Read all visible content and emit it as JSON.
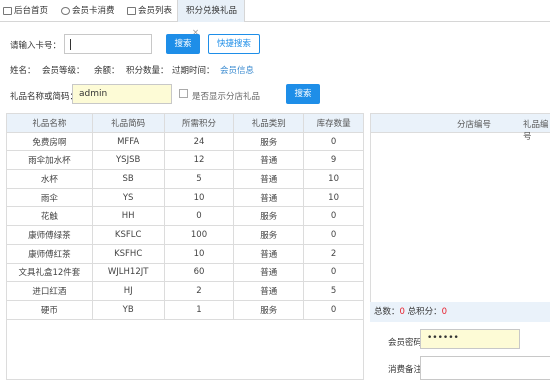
{
  "tabs": [
    {
      "label": "后台首页",
      "icon": "home-icon"
    },
    {
      "label": "会员卡消费",
      "icon": "user-icon"
    },
    {
      "label": "会员列表",
      "icon": "list-icon"
    },
    {
      "label": "积分兑换礼品",
      "icon": "",
      "close": "×"
    }
  ],
  "card": {
    "label": "请输入卡号：",
    "value": "",
    "search_label": "搜索",
    "quick_search_label": "快捷搜索"
  },
  "member": {
    "name_label": "姓名：",
    "level_label": "会员等级：",
    "balance_label": "余额：",
    "points_label": "积分数量：",
    "expire_label": "过期时间：",
    "info_link": "会员信息"
  },
  "gift_filter": {
    "label": "礼品名称或简码：",
    "value": "admin",
    "checkbox_label": "是否显示分店礼品",
    "search_label": "搜索"
  },
  "gifts": {
    "columns": [
      "礼品名称",
      "礼品简码",
      "所需积分",
      "礼品类别",
      "库存数量"
    ],
    "rows": [
      [
        "免费房啊",
        "MFFA",
        "24",
        "服务",
        "0"
      ],
      [
        "雨伞加水杯",
        "YSJSB",
        "12",
        "普通",
        "9"
      ],
      [
        "水杯",
        "SB",
        "5",
        "普通",
        "10"
      ],
      [
        "雨伞",
        "YS",
        "10",
        "普通",
        "10"
      ],
      [
        "花触",
        "HH",
        "0",
        "服务",
        "0"
      ],
      [
        "康师傅绿茶",
        "KSFLC",
        "100",
        "服务",
        "0"
      ],
      [
        "康师傅红茶",
        "KSFHC",
        "10",
        "普通",
        "2"
      ],
      [
        "文具礼盒12件套",
        "WJLH12JT",
        "60",
        "普通",
        "0"
      ],
      [
        "进口红酒",
        "HJ",
        "2",
        "普通",
        "5"
      ],
      [
        "硬币",
        "YB",
        "1",
        "服务",
        "0"
      ]
    ]
  },
  "branch_table": {
    "columns": [
      "分店编号",
      "礼品编号"
    ]
  },
  "summary": {
    "total_label": "总数：",
    "total_value": "0",
    "points_label": " 总积分：",
    "points_value": "0"
  },
  "password": {
    "label": "会员密码:",
    "value": "••••••"
  },
  "remark": {
    "label": "消费备注:"
  }
}
